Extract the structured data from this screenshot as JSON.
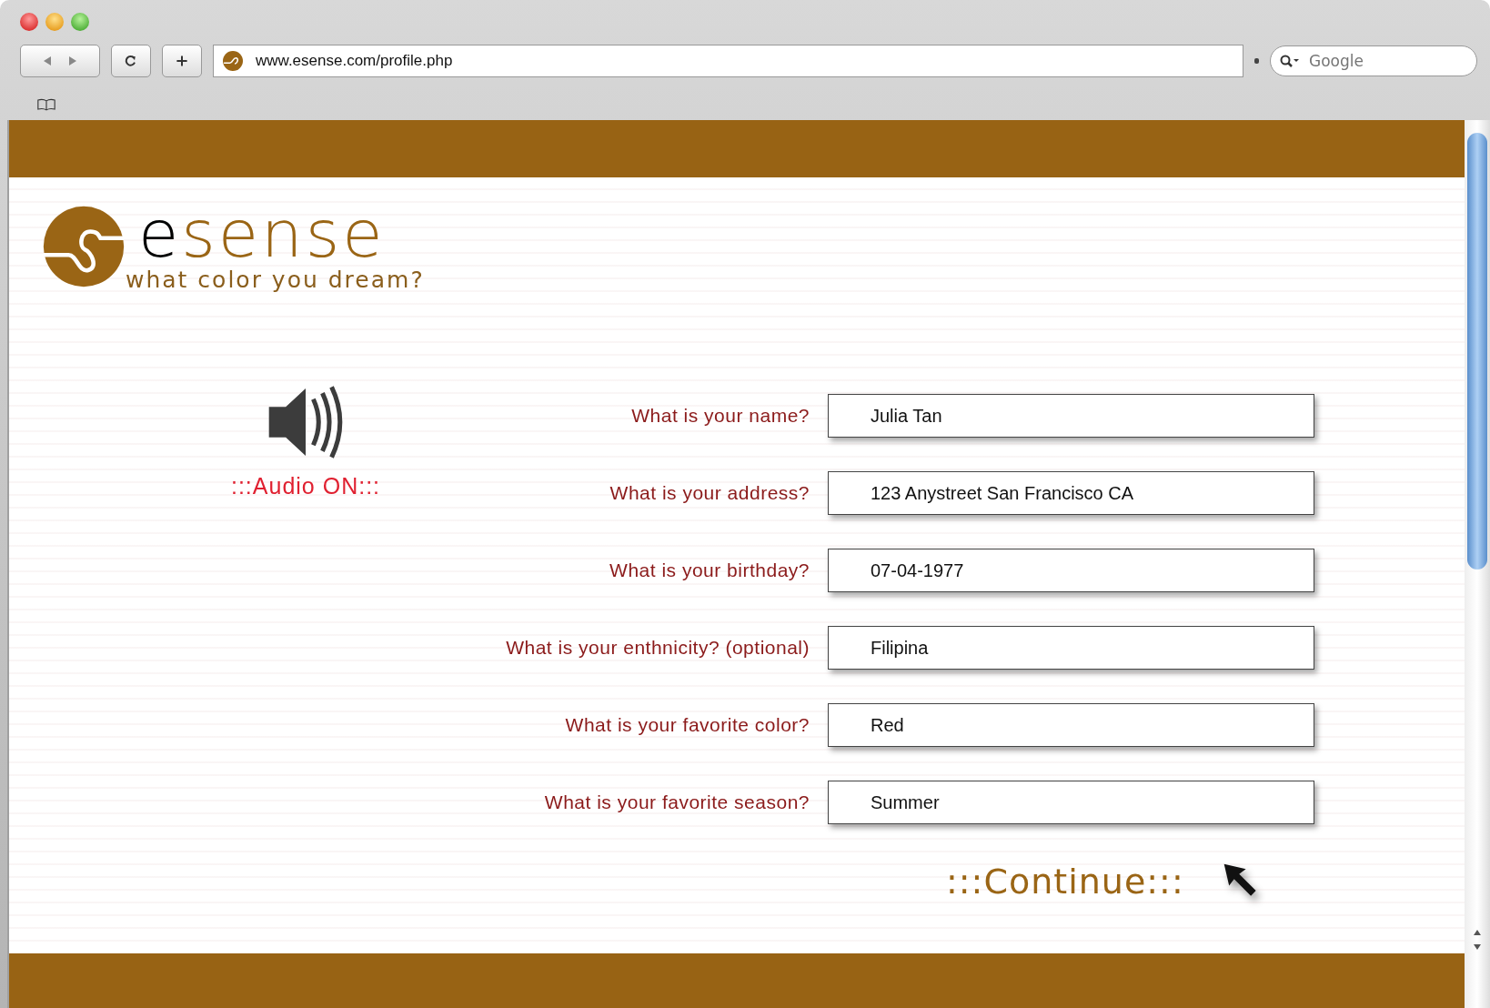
{
  "browser": {
    "url": "www.esense.com/profile.php",
    "search": {
      "placeholder": "Google"
    }
  },
  "logo": {
    "wordmark_start": "e",
    "wordmark_rest": "sense",
    "tagline": "what color you dream?"
  },
  "audio": {
    "label": ":::Audio ON:::",
    "on": true
  },
  "fields": [
    {
      "label": "What is your name?",
      "value": "Julia Tan"
    },
    {
      "label": "What is your address?",
      "value": "123 Anystreet San Francisco CA"
    },
    {
      "label": "What is your birthday?",
      "value": "07-04-1977"
    },
    {
      "label": "What is your enthnicity? (optional)",
      "value": "Filipina"
    },
    {
      "label": "What is your favorite color?",
      "value": "Red"
    },
    {
      "label": "What is your favorite season?",
      "value": "Summer"
    }
  ],
  "continue_button": ":::Continue:::"
}
